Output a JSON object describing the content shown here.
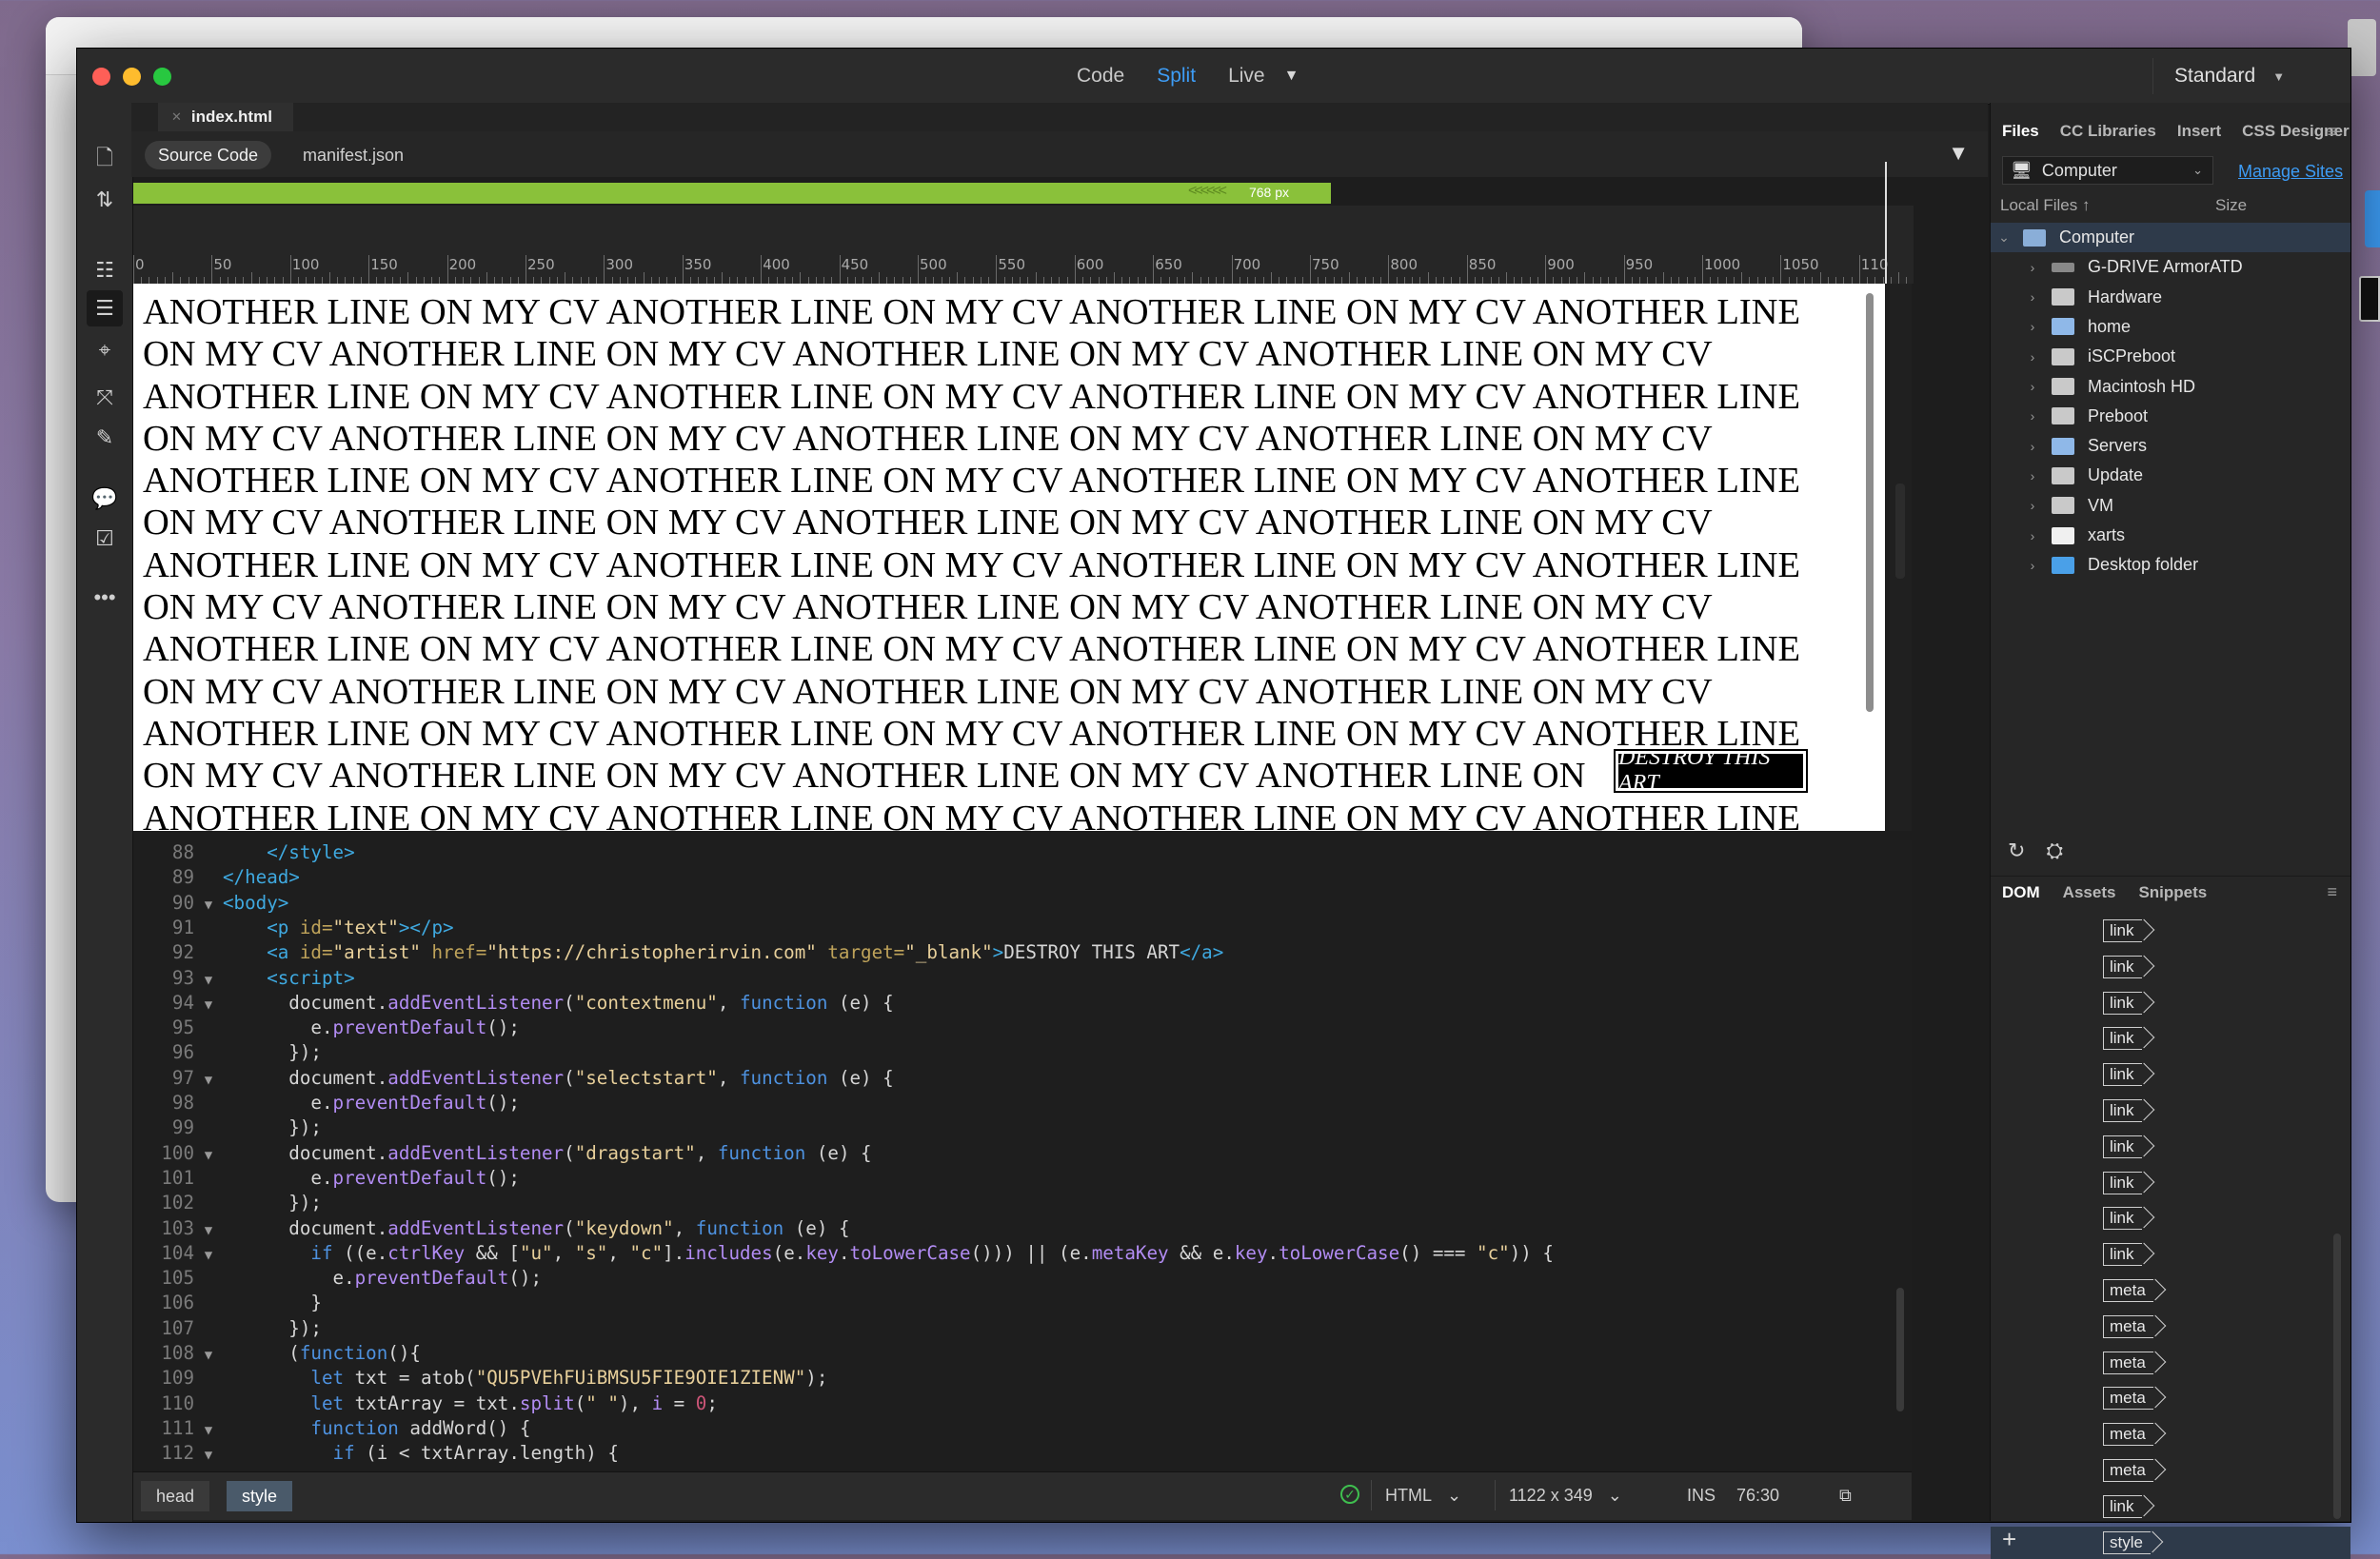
{
  "window": {
    "view_tabs": [
      "Code",
      "Split",
      "Live"
    ],
    "active_view": "Split",
    "workspace": "Standard"
  },
  "document": {
    "tab_title": "index.html",
    "related_files": [
      "Source Code",
      "manifest.json"
    ],
    "media_query_width": "768  px"
  },
  "ruler": [
    "0",
    "50",
    "100",
    "150",
    "200",
    "250",
    "300",
    "350",
    "400",
    "450",
    "500",
    "550",
    "600",
    "650",
    "700",
    "750",
    "800",
    "850",
    "900",
    "950",
    "1000",
    "1050",
    "110"
  ],
  "live_view": {
    "lines": [
      "ANOTHER LINE ON MY CV ANOTHER LINE ON MY CV ANOTHER LINE ON MY CV ANOTHER LINE",
      "ON MY CV ANOTHER LINE ON MY CV ANOTHER LINE ON MY CV ANOTHER LINE ON MY CV",
      "ANOTHER LINE ON MY CV ANOTHER LINE ON MY CV ANOTHER LINE ON MY CV ANOTHER LINE",
      "ON MY CV ANOTHER LINE ON MY CV ANOTHER LINE ON MY CV ANOTHER LINE ON MY CV",
      "ANOTHER LINE ON MY CV ANOTHER LINE ON MY CV ANOTHER LINE ON MY CV ANOTHER LINE",
      "ON MY CV ANOTHER LINE ON MY CV ANOTHER LINE ON MY CV ANOTHER LINE ON MY CV",
      "ANOTHER LINE ON MY CV ANOTHER LINE ON MY CV ANOTHER LINE ON MY CV ANOTHER LINE",
      "ON MY CV ANOTHER LINE ON MY CV ANOTHER LINE ON MY CV ANOTHER LINE ON MY CV",
      "ANOTHER LINE ON MY CV ANOTHER LINE ON MY CV ANOTHER LINE ON MY CV ANOTHER LINE",
      "ON MY CV ANOTHER LINE ON MY CV ANOTHER LINE ON MY CV ANOTHER LINE ON MY CV",
      "ANOTHER LINE ON MY CV ANOTHER LINE ON MY CV ANOTHER LINE ON MY CV ANOTHER LINE",
      "ON MY CV ANOTHER LINE ON MY CV ANOTHER LINE ON MY CV ANOTHER LINE ON",
      "ANOTHER LINE ON MY CV ANOTHER LINE ON MY CV ANOTHER LINE ON MY CV ANOTHER LINE"
    ],
    "button": "DESTROY THIS ART"
  },
  "code_view": {
    "lines": [
      {
        "n": "88",
        "fold": "",
        "parts": [
          [
            "tag",
            "    </style>"
          ]
        ]
      },
      {
        "n": "89",
        "fold": "",
        "parts": [
          [
            "tag",
            "</head>"
          ]
        ]
      },
      {
        "n": "90",
        "fold": "▼",
        "parts": [
          [
            "tag",
            "<body>"
          ]
        ]
      },
      {
        "n": "91",
        "fold": "",
        "parts": [
          [
            "tag",
            "    <p "
          ],
          [
            "attr",
            "id="
          ],
          [
            "str",
            "\"text\""
          ],
          [
            "tag",
            "></p>"
          ]
        ]
      },
      {
        "n": "92",
        "fold": "",
        "parts": [
          [
            "tag",
            "    <a "
          ],
          [
            "attr",
            "id="
          ],
          [
            "str",
            "\"artist\" "
          ],
          [
            "attr",
            "href="
          ],
          [
            "str",
            "\"https://christopherirvin.com\" "
          ],
          [
            "attr",
            "target="
          ],
          [
            "str",
            "\"_blank\""
          ],
          [
            "tag",
            ">"
          ],
          [
            "plain",
            "DESTROY THIS ART"
          ],
          [
            "tag",
            "</a>"
          ]
        ]
      },
      {
        "n": "93",
        "fold": "▼",
        "parts": [
          [
            "tag",
            "    <script>"
          ]
        ]
      },
      {
        "n": "94",
        "fold": "▼",
        "parts": [
          [
            "plain",
            "      document."
          ],
          [
            "meth",
            "addEventListener"
          ],
          [
            "plain",
            "("
          ],
          [
            "str",
            "\"contextmenu\""
          ],
          [
            "plain",
            ", "
          ],
          [
            "kw",
            "function"
          ],
          [
            "plain",
            " (e) {"
          ]
        ]
      },
      {
        "n": "95",
        "fold": "",
        "parts": [
          [
            "plain",
            "        e."
          ],
          [
            "meth",
            "preventDefault"
          ],
          [
            "plain",
            "();"
          ]
        ]
      },
      {
        "n": "96",
        "fold": "",
        "parts": [
          [
            "plain",
            "      });"
          ]
        ]
      },
      {
        "n": "97",
        "fold": "▼",
        "parts": [
          [
            "plain",
            "      document."
          ],
          [
            "meth",
            "addEventListener"
          ],
          [
            "plain",
            "("
          ],
          [
            "str",
            "\"selectstart\""
          ],
          [
            "plain",
            ", "
          ],
          [
            "kw",
            "function"
          ],
          [
            "plain",
            " (e) {"
          ]
        ]
      },
      {
        "n": "98",
        "fold": "",
        "parts": [
          [
            "plain",
            "        e."
          ],
          [
            "meth",
            "preventDefault"
          ],
          [
            "plain",
            "();"
          ]
        ]
      },
      {
        "n": "99",
        "fold": "",
        "parts": [
          [
            "plain",
            "      });"
          ]
        ]
      },
      {
        "n": "100",
        "fold": "▼",
        "parts": [
          [
            "plain",
            "      document."
          ],
          [
            "meth",
            "addEventListener"
          ],
          [
            "plain",
            "("
          ],
          [
            "str",
            "\"dragstart\""
          ],
          [
            "plain",
            ", "
          ],
          [
            "kw",
            "function"
          ],
          [
            "plain",
            " (e) {"
          ]
        ]
      },
      {
        "n": "101",
        "fold": "",
        "parts": [
          [
            "plain",
            "        e."
          ],
          [
            "meth",
            "preventDefault"
          ],
          [
            "plain",
            "();"
          ]
        ]
      },
      {
        "n": "102",
        "fold": "",
        "parts": [
          [
            "plain",
            "      });"
          ]
        ]
      },
      {
        "n": "103",
        "fold": "▼",
        "parts": [
          [
            "plain",
            "      document."
          ],
          [
            "meth",
            "addEventListener"
          ],
          [
            "plain",
            "("
          ],
          [
            "str",
            "\"keydown\""
          ],
          [
            "plain",
            ", "
          ],
          [
            "kw",
            "function"
          ],
          [
            "plain",
            " (e) {"
          ]
        ]
      },
      {
        "n": "104",
        "fold": "▼",
        "parts": [
          [
            "kw",
            "        if"
          ],
          [
            "plain",
            " ((e."
          ],
          [
            "meth",
            "ctrlKey"
          ],
          [
            "plain",
            " && ["
          ],
          [
            "str",
            "\"u\""
          ],
          [
            "plain",
            ", "
          ],
          [
            "str",
            "\"s\""
          ],
          [
            "plain",
            ", "
          ],
          [
            "str",
            "\"c\""
          ],
          [
            "plain",
            "]."
          ],
          [
            "meth",
            "includes"
          ],
          [
            "plain",
            "(e."
          ],
          [
            "meth",
            "key"
          ],
          [
            "plain",
            "."
          ],
          [
            "meth",
            "toLowerCase"
          ],
          [
            "plain",
            "())) || (e."
          ],
          [
            "meth",
            "metaKey"
          ],
          [
            "plain",
            " && e."
          ],
          [
            "meth",
            "key"
          ],
          [
            "plain",
            "."
          ],
          [
            "meth",
            "toLowerCase"
          ],
          [
            "plain",
            "() === "
          ],
          [
            "str",
            "\"c\""
          ],
          [
            "plain",
            ")) {"
          ]
        ]
      },
      {
        "n": "105",
        "fold": "",
        "parts": [
          [
            "plain",
            "          e."
          ],
          [
            "meth",
            "preventDefault"
          ],
          [
            "plain",
            "();"
          ]
        ]
      },
      {
        "n": "106",
        "fold": "",
        "parts": [
          [
            "plain",
            "        }"
          ]
        ]
      },
      {
        "n": "107",
        "fold": "",
        "parts": [
          [
            "plain",
            "      });"
          ]
        ]
      },
      {
        "n": "108",
        "fold": "▼",
        "parts": [
          [
            "plain",
            "      ("
          ],
          [
            "kw",
            "function"
          ],
          [
            "plain",
            "(){"
          ]
        ]
      },
      {
        "n": "109",
        "fold": "",
        "parts": [
          [
            "kw",
            "        let"
          ],
          [
            "plain",
            " txt = atob("
          ],
          [
            "str",
            "\"QU5PVEhFUiBMSU5FIE9OIE1ZIENW\""
          ],
          [
            "plain",
            ");"
          ]
        ]
      },
      {
        "n": "110",
        "fold": "",
        "parts": [
          [
            "kw",
            "        let"
          ],
          [
            "plain",
            " txtArray = txt."
          ],
          [
            "meth",
            "split"
          ],
          [
            "plain",
            "("
          ],
          [
            "str",
            "\" \""
          ],
          [
            "plain",
            "), "
          ],
          [
            "meth",
            "i"
          ],
          [
            "plain",
            " = "
          ],
          [
            "num",
            "0"
          ],
          [
            "plain",
            ";"
          ]
        ]
      },
      {
        "n": "111",
        "fold": "▼",
        "parts": [
          [
            "kw",
            "        function"
          ],
          [
            "plain",
            " addWord() {"
          ]
        ]
      },
      {
        "n": "112",
        "fold": "▼",
        "parts": [
          [
            "kw",
            "          if"
          ],
          [
            "plain",
            " (i < txtArray.length) {"
          ]
        ]
      }
    ]
  },
  "status": {
    "crumbs": [
      "head",
      "style"
    ],
    "doc_type": "HTML",
    "size": "1122 x 349",
    "mode": "INS",
    "position": "76:30"
  },
  "files_panel": {
    "tabs": [
      "Files",
      "CC Libraries",
      "Insert",
      "CSS Designer"
    ],
    "site": "Computer",
    "manage": "Manage Sites",
    "col_local": "Local Files ↑",
    "col_size": "Size",
    "root": "Computer",
    "items": [
      {
        "name": "G-DRIVE ArmorATD",
        "icon": "eject"
      },
      {
        "name": "Hardware",
        "icon": "disk"
      },
      {
        "name": "home",
        "icon": "net"
      },
      {
        "name": "iSCPreboot",
        "icon": "disk"
      },
      {
        "name": "Macintosh HD",
        "icon": "disk"
      },
      {
        "name": "Preboot",
        "icon": "disk"
      },
      {
        "name": "Servers",
        "icon": "net"
      },
      {
        "name": "Update",
        "icon": "disk"
      },
      {
        "name": "VM",
        "icon": "disk"
      },
      {
        "name": "xarts",
        "icon": "doc"
      },
      {
        "name": "Desktop folder",
        "icon": "folder"
      }
    ]
  },
  "dom_panel": {
    "tabs": [
      "DOM",
      "Assets",
      "Snippets"
    ],
    "nodes": [
      "link",
      "link",
      "link",
      "link",
      "link",
      "link",
      "link",
      "link",
      "link",
      "link",
      "meta",
      "meta",
      "meta",
      "meta",
      "meta",
      "meta",
      "link",
      "style"
    ],
    "selected": "style"
  }
}
